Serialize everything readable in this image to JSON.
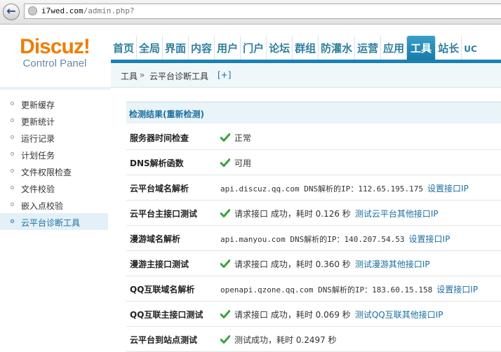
{
  "browser": {
    "back_icon": "back-arrow-icon",
    "url_host": "i7wed.com",
    "url_path": "/admin.php?"
  },
  "logo": {
    "brand": "Discuz!",
    "subtitle": "Control Panel"
  },
  "topnav": [
    "首页",
    "全局",
    "界面",
    "内容",
    "用户",
    "门户",
    "论坛",
    "群组",
    "防灌水",
    "运营",
    "应用",
    "工具",
    "站长",
    "UC"
  ],
  "topnav_active": "工具",
  "breadcrumb": {
    "section": "工具",
    "separator": "»",
    "page": "云平台诊断工具",
    "plus": "[+]"
  },
  "sidebar": [
    {
      "label": "更新缓存"
    },
    {
      "label": "更新统计"
    },
    {
      "label": "运行记录"
    },
    {
      "label": "计划任务"
    },
    {
      "label": "文件权限检查"
    },
    {
      "label": "文件校验"
    },
    {
      "label": "嵌入点校验"
    },
    {
      "label": "云平台诊断工具",
      "active": true
    }
  ],
  "results": {
    "heading": "检测结果(重新检测)",
    "rows": [
      {
        "name": "服务器时间检查",
        "check": true,
        "text": "正常"
      },
      {
        "name": "DNS解析函数",
        "check": true,
        "text": "可用"
      },
      {
        "name": "云平台域名解析",
        "check": false,
        "mono": "api.discuz.qq.com DNS解析的IP：112.65.195.175",
        "link": "设置接口IP"
      },
      {
        "name": "云平台主接口测试",
        "check": true,
        "text": "请求接口 成功，耗时 0.126 秒",
        "link": "测试云平台其他接口IP"
      },
      {
        "name": "漫游域名解析",
        "check": false,
        "mono": "api.manyou.com DNS解析的IP：140.207.54.53",
        "link": "设置接口IP"
      },
      {
        "name": "漫游主接口测试",
        "check": true,
        "text": "请求接口 成功，耗时 0.360 秒",
        "link": "测试漫游其他接口IP"
      },
      {
        "name": "QQ互联域名解析",
        "check": false,
        "mono": "openapi.qzone.qq.com DNS解析的IP：183.60.15.158",
        "link": "设置接口IP"
      },
      {
        "name": "QQ互联主接口测试",
        "check": true,
        "text": "请求接口 成功，耗时 0.069 秒",
        "link": "测试QQ互联其他接口IP"
      },
      {
        "name": "云平台到站点测试",
        "check": true,
        "text": "测试成功，耗时 0.2497 秒"
      }
    ]
  },
  "colors": {
    "accent": "#1a6fa0",
    "brand": "#ef7d00",
    "check": "#3aa33a"
  }
}
